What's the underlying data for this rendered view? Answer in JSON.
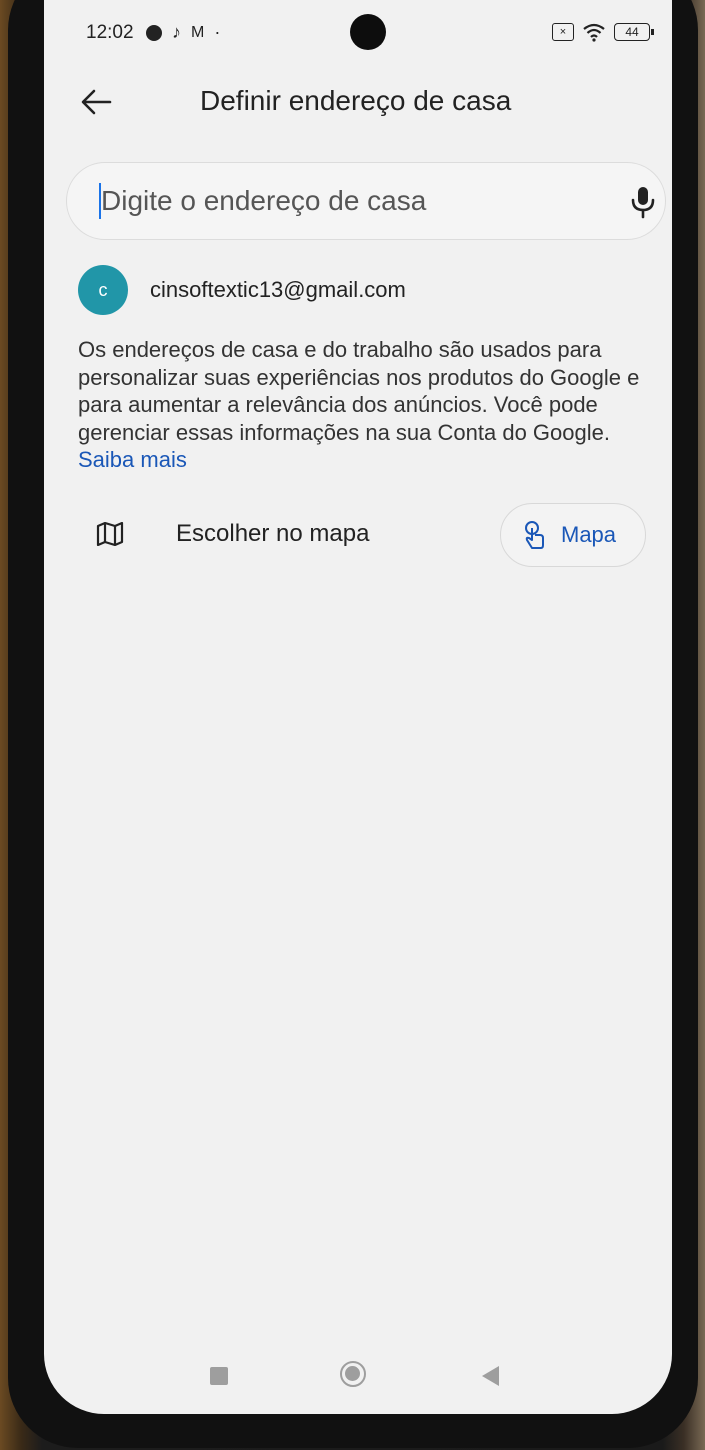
{
  "status_bar": {
    "time": "12:02",
    "left_icons": [
      "app-notification-icon",
      "tiktok-icon",
      "gmail-icon",
      "more-dot-icon"
    ],
    "battery": "44",
    "right_icons": [
      "no-sim-icon",
      "wifi-icon",
      "battery-icon"
    ]
  },
  "app_bar": {
    "back_icon": "arrow-back-icon",
    "title": "Definir endereço de casa"
  },
  "search": {
    "placeholder": "Digite o endereço de casa",
    "value": "",
    "mic_icon": "mic-icon"
  },
  "account": {
    "avatar_letter": "c",
    "avatar_color": "#2196a8",
    "email": "cinsoftextic13@gmail.com"
  },
  "info": {
    "text": "Os endereços de casa e do trabalho são usados para personalizar suas experiências nos produtos do Google e para aumentar a relevância dos anúncios. Você pode gerenciar essas informações na sua Conta do Google. ",
    "link_label": "Saiba mais",
    "link_color": "#1a57b7"
  },
  "choose_on_map": {
    "icon": "map-icon",
    "label": "Escolher no mapa",
    "button_icon": "touch-icon",
    "button_label": "Mapa"
  },
  "nav_bar": {
    "items": [
      "recents-button",
      "home-button",
      "back-button"
    ]
  }
}
